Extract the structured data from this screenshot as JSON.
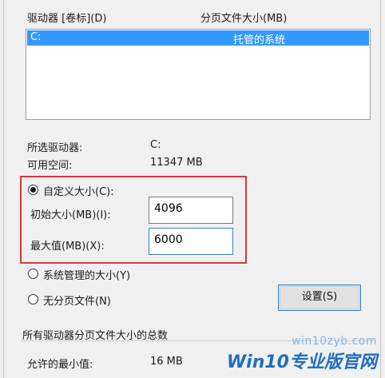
{
  "list": {
    "header_drive": "驱动器 [卷标](D)",
    "header_size": "分页文件大小(MB)",
    "rows": [
      {
        "drive": "C:",
        "size": "托管的系统"
      }
    ]
  },
  "info": {
    "selected_drive_label": "所选驱动器:",
    "selected_drive_value": "C:",
    "free_space_label": "可用空间:",
    "free_space_value": "11347 MB"
  },
  "options": {
    "custom_size_label": "自定义大小(C):",
    "initial_size_label": "初始大小(MB)(I):",
    "initial_size_value": "4096",
    "max_size_label": "最大值(MB)(X):",
    "max_size_value": "6000",
    "system_managed_label": "系统管理的大小(Y)",
    "no_paging_label": "无分页文件(N)",
    "selected": "custom"
  },
  "set_button": "设置(S)",
  "totals": {
    "group_title": "所有驱动器分页文件大小的总数",
    "min_allowed_label": "允许的最小值:",
    "min_allowed_value": "16 MB"
  },
  "watermark": {
    "url": "win10zyb.com",
    "brand": "Win10",
    "brand_sub": "专业版官网"
  },
  "colors": {
    "selection": "#3399ff",
    "highlight_box": "#d9373b",
    "watermark": "#1e6fc0"
  }
}
